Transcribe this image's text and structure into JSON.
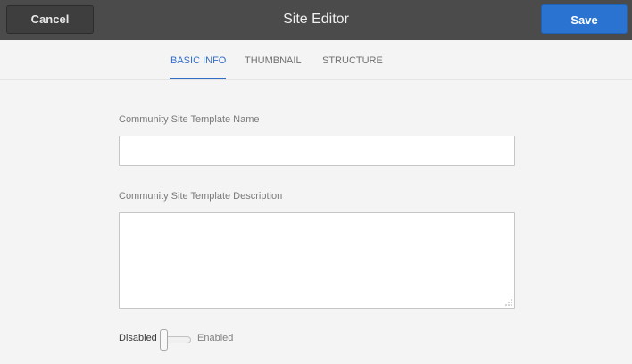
{
  "header": {
    "title": "Site Editor",
    "cancel_label": "Cancel",
    "save_label": "Save"
  },
  "tabs": [
    {
      "label": "BASIC INFO",
      "active": true
    },
    {
      "label": "THUMBNAIL",
      "active": false
    },
    {
      "label": "STRUCTURE",
      "active": false
    }
  ],
  "form": {
    "name_field": {
      "label": "Community Site Template Name",
      "value": "",
      "placeholder": ""
    },
    "description_field": {
      "label": "Community Site Template Description",
      "value": "",
      "placeholder": ""
    },
    "status_switch": {
      "off_label": "Disabled",
      "on_label": "Enabled",
      "checked": false
    }
  },
  "colors": {
    "header_bg": "#4b4b4b",
    "primary": "#2b73d0",
    "active_tab": "#326ec8",
    "page_bg": "#f4f4f4"
  },
  "icons": {
    "resize_handle": "resize-grip-icon"
  }
}
